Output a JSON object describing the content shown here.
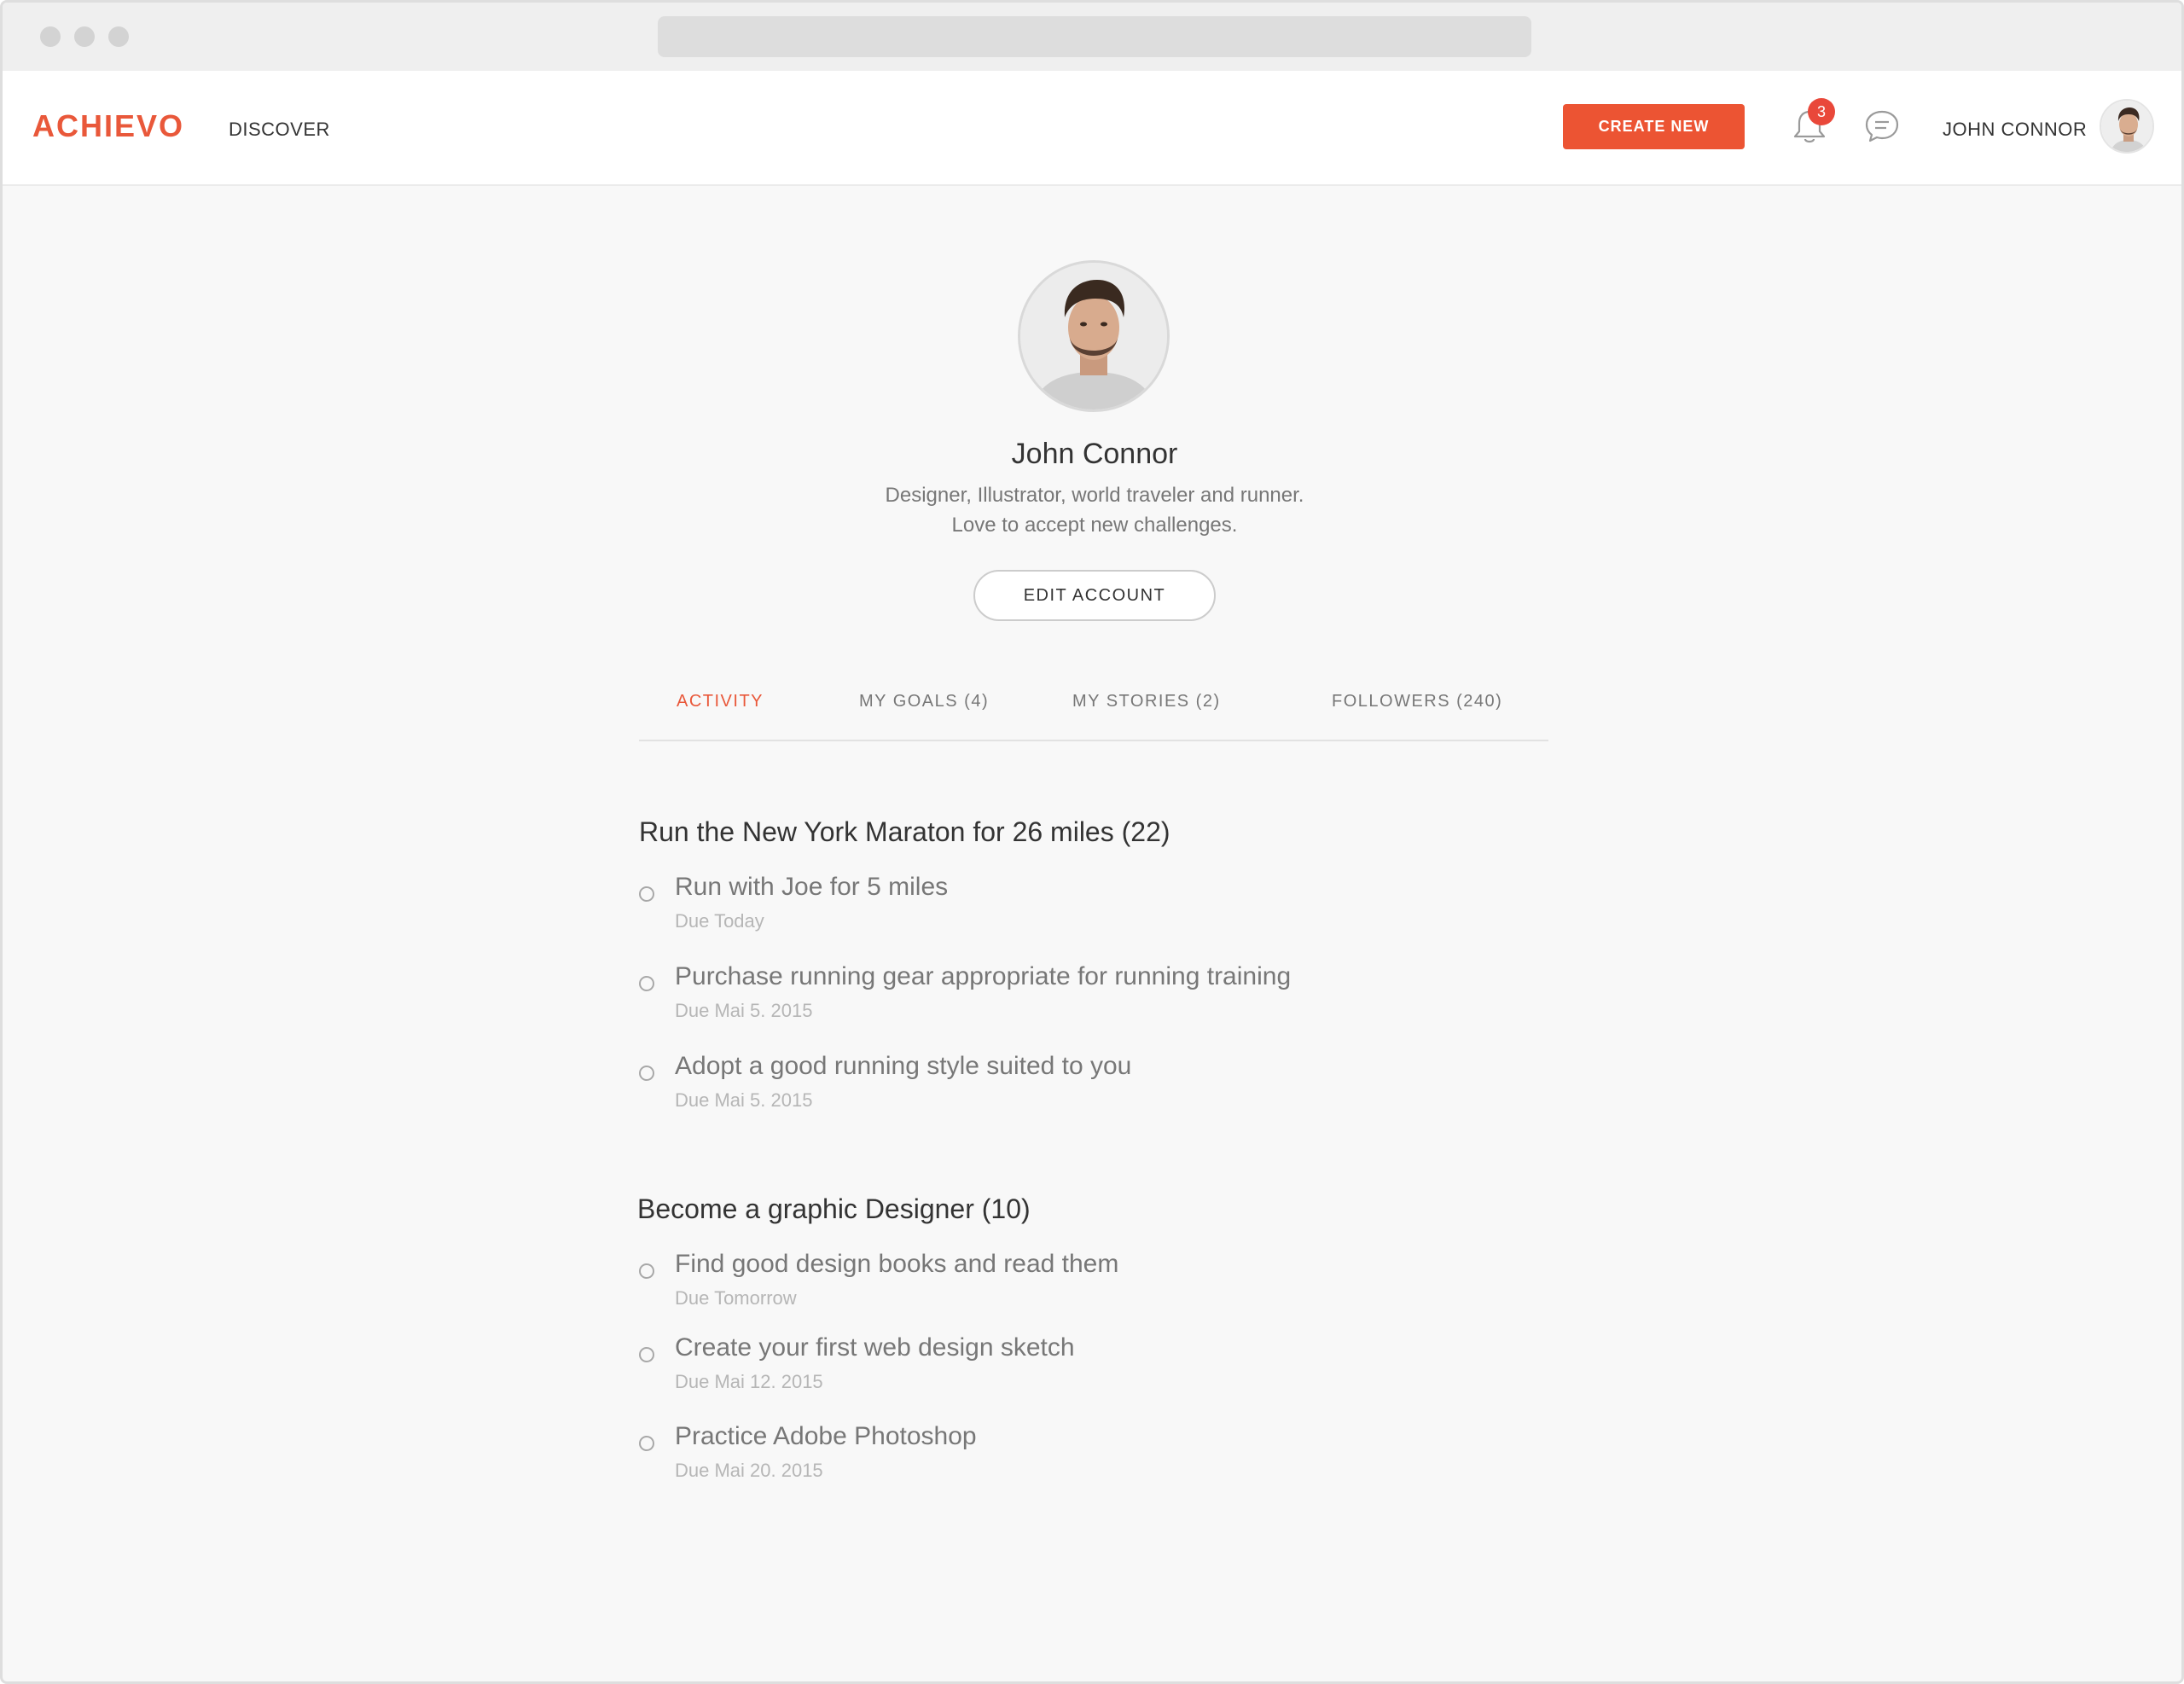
{
  "header": {
    "logo": "ACHIEVO",
    "nav_discover": "DISCOVER",
    "create_new_label": "CREATE NEW",
    "notification_count": "3",
    "user_name": "JOHN CONNOR"
  },
  "profile": {
    "name": "John Connor",
    "bio_line1": "Designer, Illustrator, world traveler and runner.",
    "bio_line2": "Love to accept new challenges.",
    "edit_account_label": "EDIT ACCOUNT"
  },
  "tabs": [
    {
      "label": "ACTIVITY",
      "active": true
    },
    {
      "label": "MY GOALS (4)",
      "active": false
    },
    {
      "label": "MY STORIES (2)",
      "active": false
    },
    {
      "label": "FOLLOWERS (240)",
      "active": false
    }
  ],
  "goals": [
    {
      "title": "Run the New York Maraton for 26 miles (22)",
      "tasks": [
        {
          "title": "Run with Joe for 5 miles",
          "due": "Due Today"
        },
        {
          "title": "Purchase running gear appropriate for running training",
          "due": "Due Mai 5. 2015"
        },
        {
          "title": "Adopt a good running style suited to you",
          "due": "Due Mai 5. 2015"
        }
      ]
    },
    {
      "title": "Become a graphic Designer (10)",
      "tasks": [
        {
          "title": "Find good design books and read them",
          "due": "Due Tomorrow"
        },
        {
          "title": "Create your first web design sketch",
          "due": "Due Mai 12. 2015"
        },
        {
          "title": "Practice Adobe Photoshop",
          "due": "Due Mai 20. 2015"
        }
      ]
    }
  ],
  "icons": {
    "notification": "bell-icon",
    "messages": "chat-icon",
    "avatar": "user-avatar",
    "task_status": "circle-outline-icon"
  },
  "colors": {
    "accent": "#e9583a",
    "button": "#ec5433",
    "badge": "#e9483a",
    "text_dark": "#333333",
    "text_muted": "#777777",
    "text_light": "#b6b6b6",
    "background": "#f8f8f8"
  }
}
